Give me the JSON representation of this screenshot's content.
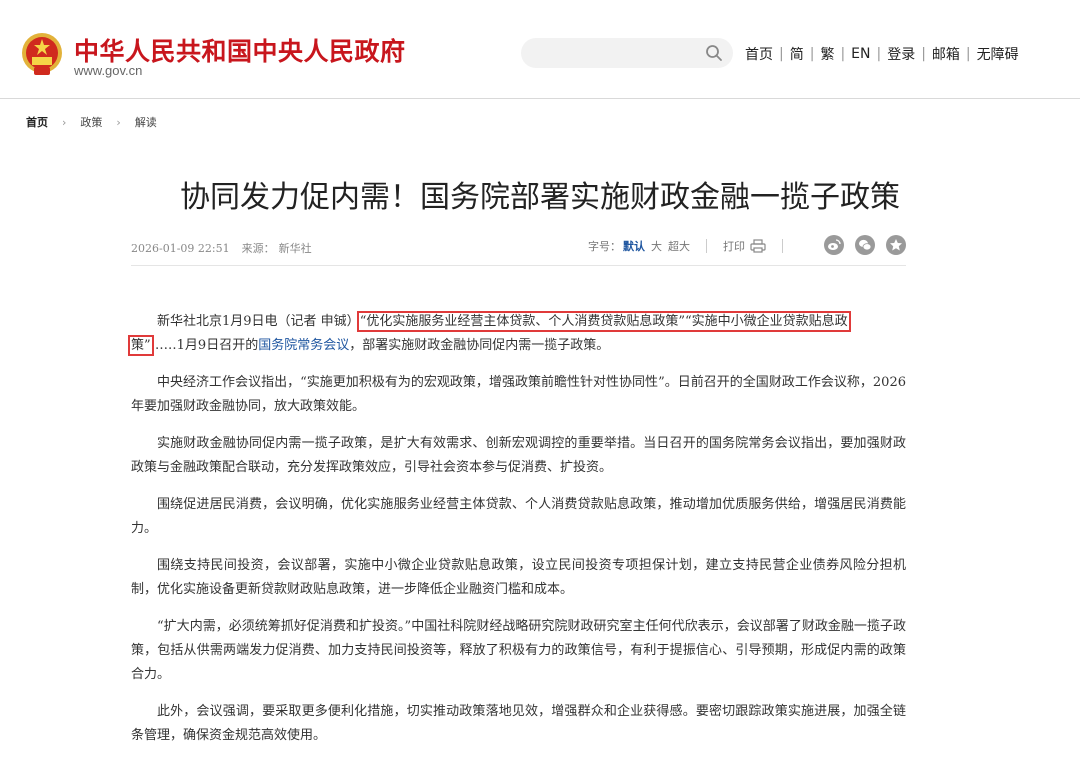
{
  "site": {
    "title": "中华人民共和国中央人民政府",
    "domain": "www.gov.cn"
  },
  "search": {
    "placeholder": ""
  },
  "nav": {
    "home": "首页",
    "simplified": "简",
    "traditional": "繁",
    "english": "EN",
    "login": "登录",
    "mail": "邮箱",
    "accessibility": "无障碍"
  },
  "breadcrumb": {
    "home": "首页",
    "policy": "政策",
    "interpretation": "解读"
  },
  "article": {
    "title": "协同发力促内需！国务院部署实施财政金融一揽子政策",
    "date": "2026-01-09 22:51",
    "source_label": "来源：",
    "source": "新华社",
    "font_size_label": "字号：",
    "font_default": "默认",
    "font_large": "大",
    "font_xlarge": "超大",
    "print_label": "打印",
    "p1": {
      "lead": "新华社北京1月9日电（记者 申铖）",
      "quote_a": "“优化实施服务业经营主体贷款、个人消费贷款贴息政策”“实施中小微企业贷款贴息政",
      "quote_b": "策”",
      "mid": "……1月9日召开的",
      "link": "国务院常务会议",
      "tail": "，部署实施财政金融协同促内需一揽子政策。"
    },
    "paragraphs": [
      "中央经济工作会议指出，“实施更加积极有为的宏观政策，增强政策前瞻性针对性协同性”。日前召开的全国财政工作会议称，2026年要加强财政金融协同，放大政策效能。",
      "实施财政金融协同促内需一揽子政策，是扩大有效需求、创新宏观调控的重要举措。当日召开的国务院常务会议指出，要加强财政政策与金融政策配合联动，充分发挥政策效应，引导社会资本参与促消费、扩投资。",
      "围绕促进居民消费，会议明确，优化实施服务业经营主体贷款、个人消费贷款贴息政策，推动增加优质服务供给，增强居民消费能力。",
      "围绕支持民间投资，会议部署，实施中小微企业贷款贴息政策，设立民间投资专项担保计划，建立支持民营企业债券风险分担机制，优化实施设备更新贷款财政贴息政策，进一步降低企业融资门槛和成本。",
      "“扩大内需，必须统筹抓好促消费和扩投资。”中国社科院财经战略研究院财政研究室主任何代欣表示，会议部署了财政金融一揽子政策，包括从供需两端发力促消费、加力支持民间投资等，释放了积极有力的政策信号，有利于提振信心、引导预期，形成促内需的政策合力。",
      "此外，会议强调，要采取更多便利化措施，切实推动政策落地见效，增强群众和企业获得感。要密切跟踪政策实施进展，加强全链条管理，确保资金规范高效使用。"
    ]
  },
  "colors": {
    "brand_red": "#c8161d",
    "link_blue": "#1f56a0",
    "highlight_red": "#e03a3a"
  },
  "icons": [
    "national-emblem-icon",
    "search-icon",
    "print-icon",
    "weibo-icon",
    "wechat-icon",
    "favorite-icon"
  ]
}
